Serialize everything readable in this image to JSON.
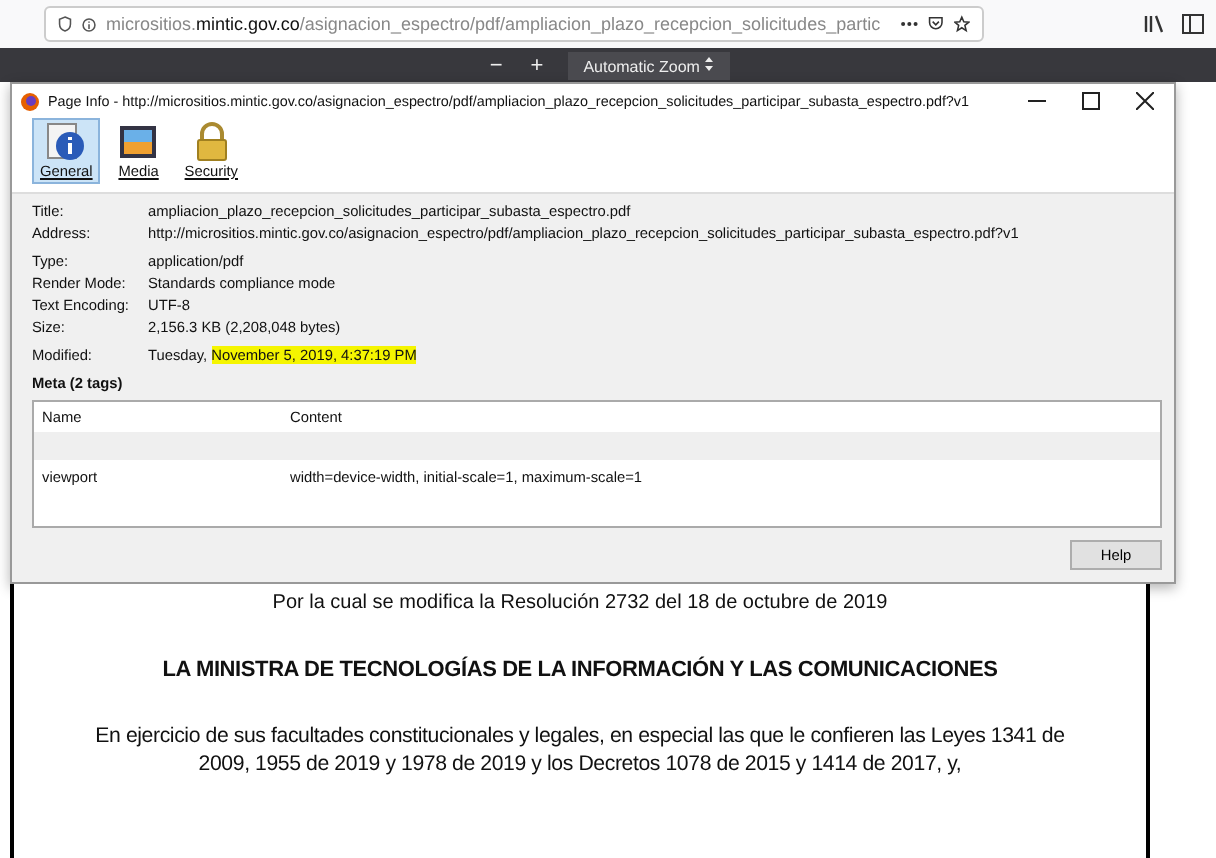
{
  "address_bar": {
    "url_prefix": "micrositios.",
    "url_host": "mintic.gov.co",
    "url_path": "/asignacion_espectro/pdf/ampliacion_plazo_recepcion_solicitudes_partic"
  },
  "pdf_toolbar": {
    "zoom_out": "−",
    "zoom_in": "+",
    "zoom": "Automatic Zoom"
  },
  "dialog": {
    "title": "Page Info - http://micrositios.mintic.gov.co/asignacion_espectro/pdf/ampliacion_plazo_recepcion_solicitudes_participar_subasta_espectro.pdf?v1",
    "tabs": [
      {
        "label": "General",
        "kind": "info",
        "selected": true
      },
      {
        "label": "Media",
        "kind": "media",
        "selected": false
      },
      {
        "label": "Security",
        "kind": "security",
        "selected": false
      }
    ],
    "field_groups": [
      [
        {
          "label": "Title:",
          "value": "ampliacion_plazo_recepcion_solicitudes_participar_subasta_espectro.pdf"
        },
        {
          "label": "Address:",
          "value": "http://micrositios.mintic.gov.co/asignacion_espectro/pdf/ampliacion_plazo_recepcion_solicitudes_participar_subasta_espectro.pdf?v1"
        }
      ],
      [
        {
          "label": "Type:",
          "value": "application/pdf"
        },
        {
          "label": "Render Mode:",
          "value": "Standards compliance mode"
        },
        {
          "label": "Text Encoding:",
          "value": "UTF-8"
        },
        {
          "label": "Size:",
          "value": "2,156.3 KB (2,208,048 bytes)"
        }
      ],
      [
        {
          "label": "Modified:",
          "value": "Tuesday,",
          "highlighted": "November 5, 2019, 4:37:19 PM"
        }
      ]
    ],
    "meta_heading": "Meta (2 tags)",
    "columns": [
      "Name",
      "Content"
    ],
    "rows": [
      {
        "name": "viewport",
        "content": "width=device-width, initial-scale=1, maximum-scale=1"
      }
    ],
    "help_button": "Help"
  },
  "document": {
    "subtitle": "Por la cual se modifica la Resolución 2732 del 18 de octubre de 2019",
    "heading": "LA MINISTRA DE TECNOLOGÍAS DE LA INFORMACIÓN Y LAS COMUNICACIONES",
    "paragraph": "En ejercicio de sus facultades constitucionales y legales, en especial las que le confieren las Leyes 1341 de 2009, 1955 de 2019 y 1978 de 2019 y los Decretos 1078 de 2015 y 1414 de 2017, y,"
  }
}
